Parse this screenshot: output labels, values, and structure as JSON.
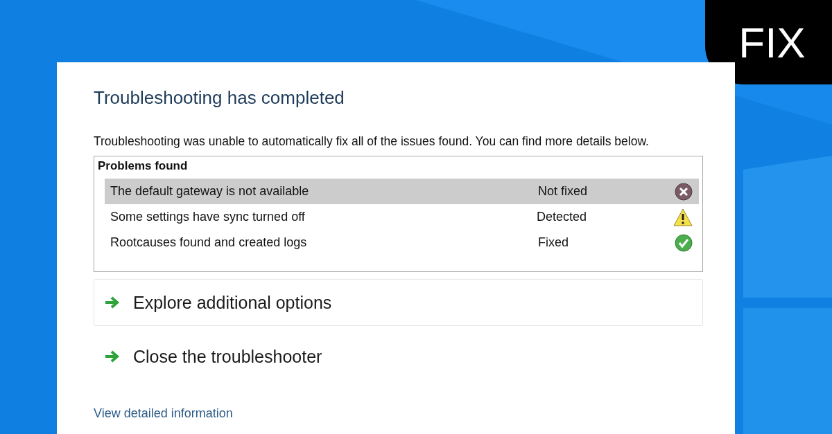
{
  "badge": {
    "label": "FIX"
  },
  "dialog": {
    "title": "Troubleshooting has completed",
    "message": "Troubleshooting was unable to automatically fix all of the issues found. You can find more details below.",
    "problems": {
      "heading": "Problems found",
      "rows": [
        {
          "problem": "The default gateway is not available",
          "status": "Not fixed",
          "kind": "error",
          "selected": true
        },
        {
          "problem": "Some settings have sync turned off",
          "status": "Detected",
          "kind": "warning",
          "selected": false
        },
        {
          "problem": "Rootcauses found and created logs",
          "status": "Fixed",
          "kind": "fixed",
          "selected": false
        }
      ]
    },
    "options": [
      {
        "label": "Explore additional options",
        "bordered": true
      },
      {
        "label": "Close the troubleshooter",
        "bordered": false
      }
    ],
    "link": "View detailed information"
  }
}
